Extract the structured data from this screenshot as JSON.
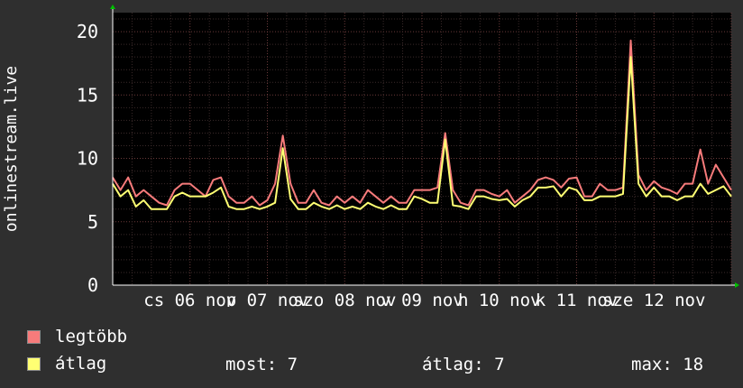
{
  "chart_data": {
    "type": "line",
    "ylabel": "onlinestream.live",
    "ylim": [
      0,
      21.5
    ],
    "yticks": [
      0,
      5,
      10,
      15,
      20
    ],
    "grid": true,
    "xticks": [
      "cs 06 nov",
      "p 07 nov",
      "szo 08 nov",
      "v 09 nov",
      "h 10 nov",
      "k 11 nov",
      "sze 12 nov"
    ],
    "colors": {
      "legtobb": "#f77b7b",
      "atlag": "#ffff73"
    },
    "x_days": [
      0,
      0.1,
      0.2,
      0.3,
      0.4,
      0.5,
      0.6,
      0.7,
      0.8,
      0.9,
      1,
      1.1,
      1.2,
      1.3,
      1.4,
      1.5,
      1.6,
      1.7,
      1.8,
      1.9,
      2,
      2.1,
      2.2,
      2.3,
      2.4,
      2.5,
      2.6,
      2.7,
      2.8,
      2.9,
      3,
      3.1,
      3.2,
      3.3,
      3.4,
      3.5,
      3.6,
      3.7,
      3.8,
      3.9,
      4,
      4.1,
      4.2,
      4.3,
      4.4,
      4.5,
      4.6,
      4.7,
      4.8,
      4.9,
      5,
      5.1,
      5.2,
      5.3,
      5.4,
      5.5,
      5.6,
      5.7,
      5.8,
      5.9,
      6,
      6.1,
      6.2,
      6.3,
      6.4,
      6.5,
      6.6,
      6.7,
      6.8,
      6.9,
      7,
      7.1,
      7.2,
      7.3,
      7.4,
      7.5,
      7.6,
      7.7,
      7.8,
      7.9,
      8
    ],
    "series": [
      {
        "name": "legtöbb",
        "values": [
          8.5,
          7.5,
          8.5,
          7,
          7.5,
          7,
          6.5,
          6.3,
          7.5,
          8,
          8,
          7.5,
          7,
          8.3,
          8.5,
          7,
          6.5,
          6.5,
          7,
          6.3,
          6.7,
          8,
          11.8,
          8,
          6.5,
          6.5,
          7.5,
          6.5,
          6.3,
          7,
          6.5,
          7,
          6.5,
          7.5,
          7,
          6.5,
          7,
          6.5,
          6.5,
          7.5,
          7.5,
          7.5,
          7.7,
          12,
          7.5,
          6.5,
          6.3,
          7.5,
          7.5,
          7.2,
          7,
          7.5,
          6.5,
          7,
          7.5,
          8.3,
          8.5,
          8.3,
          7.7,
          8.4,
          8.5,
          7,
          7,
          8,
          7.5,
          7.5,
          7.7,
          19.3,
          8.7,
          7.5,
          8.2,
          7.7,
          7.5,
          7.2,
          8,
          8,
          10.7,
          8,
          9.5,
          8.5,
          7.5
        ]
      },
      {
        "name": "átlag",
        "values": [
          8,
          7,
          7.5,
          6.2,
          6.7,
          6,
          6,
          6,
          7,
          7.3,
          7,
          7,
          7,
          7.3,
          7.7,
          6.2,
          6,
          6,
          6.2,
          6,
          6.2,
          6.5,
          10.8,
          6.8,
          6,
          6,
          6.5,
          6.2,
          6,
          6.3,
          6,
          6.2,
          6,
          6.5,
          6.2,
          6,
          6.3,
          6,
          6,
          7,
          6.8,
          6.5,
          6.5,
          11.5,
          6.3,
          6.2,
          6,
          7,
          7,
          6.8,
          6.7,
          6.8,
          6.2,
          6.7,
          7,
          7.7,
          7.7,
          7.8,
          7,
          7.7,
          7.5,
          6.7,
          6.7,
          7,
          7,
          7,
          7.2,
          18,
          8,
          7,
          7.7,
          7,
          7,
          6.7,
          7,
          7,
          8,
          7.2,
          7.5,
          7.8,
          7
        ]
      }
    ]
  },
  "legend": {
    "max_label": "legtöbb",
    "avg_label": "átlag"
  },
  "stats": {
    "now": "most: 7",
    "avg": "átlag: 7",
    "max": "max: 18"
  }
}
